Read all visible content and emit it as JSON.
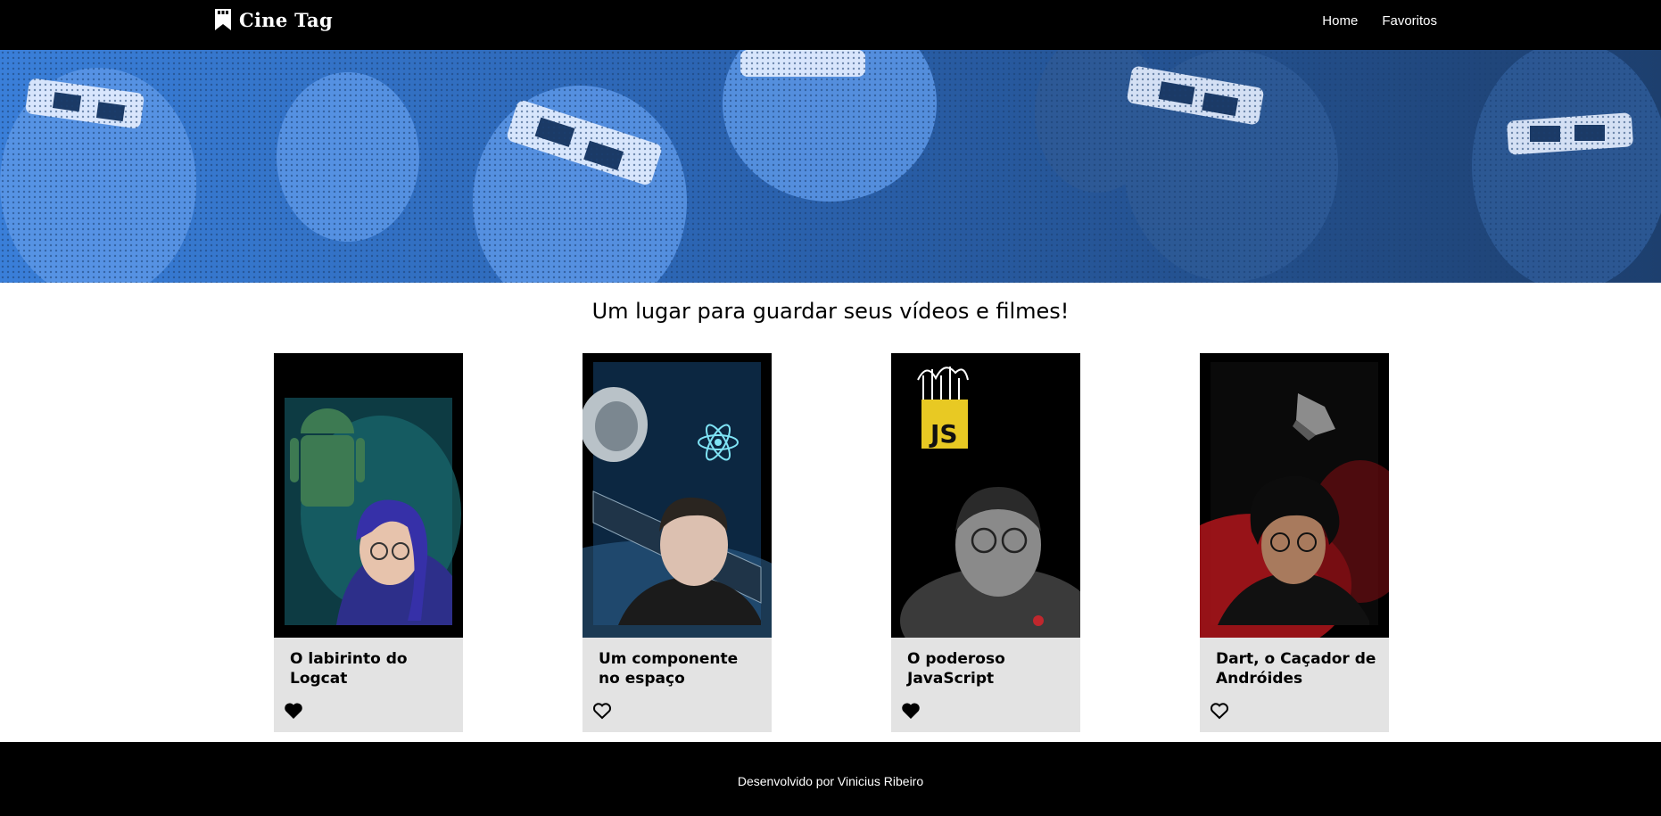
{
  "header": {
    "logo_text": "Cine Tag",
    "nav": [
      {
        "label": "Home"
      },
      {
        "label": "Favoritos"
      }
    ]
  },
  "main": {
    "subtitle": "Um lugar para guardar seus vídeos e filmes!",
    "cards": [
      {
        "title": "O labirinto do Logcat",
        "favorited": true,
        "icon": "heart-filled-icon"
      },
      {
        "title": "Um componente no espaço",
        "favorited": false,
        "icon": "heart-outline-icon"
      },
      {
        "title": "O poderoso JavaScript",
        "favorited": true,
        "icon": "heart-filled-icon"
      },
      {
        "title": "Dart, o Caçador de Andróides",
        "favorited": false,
        "icon": "heart-outline-icon"
      }
    ]
  },
  "footer": {
    "text": "Desenvolvido por Vinicius Ribeiro"
  },
  "colors": {
    "header_bg": "#000000",
    "banner_tint": "#2f6fcc",
    "card_info_bg": "#e3e3e3",
    "footer_bg": "#000000"
  }
}
